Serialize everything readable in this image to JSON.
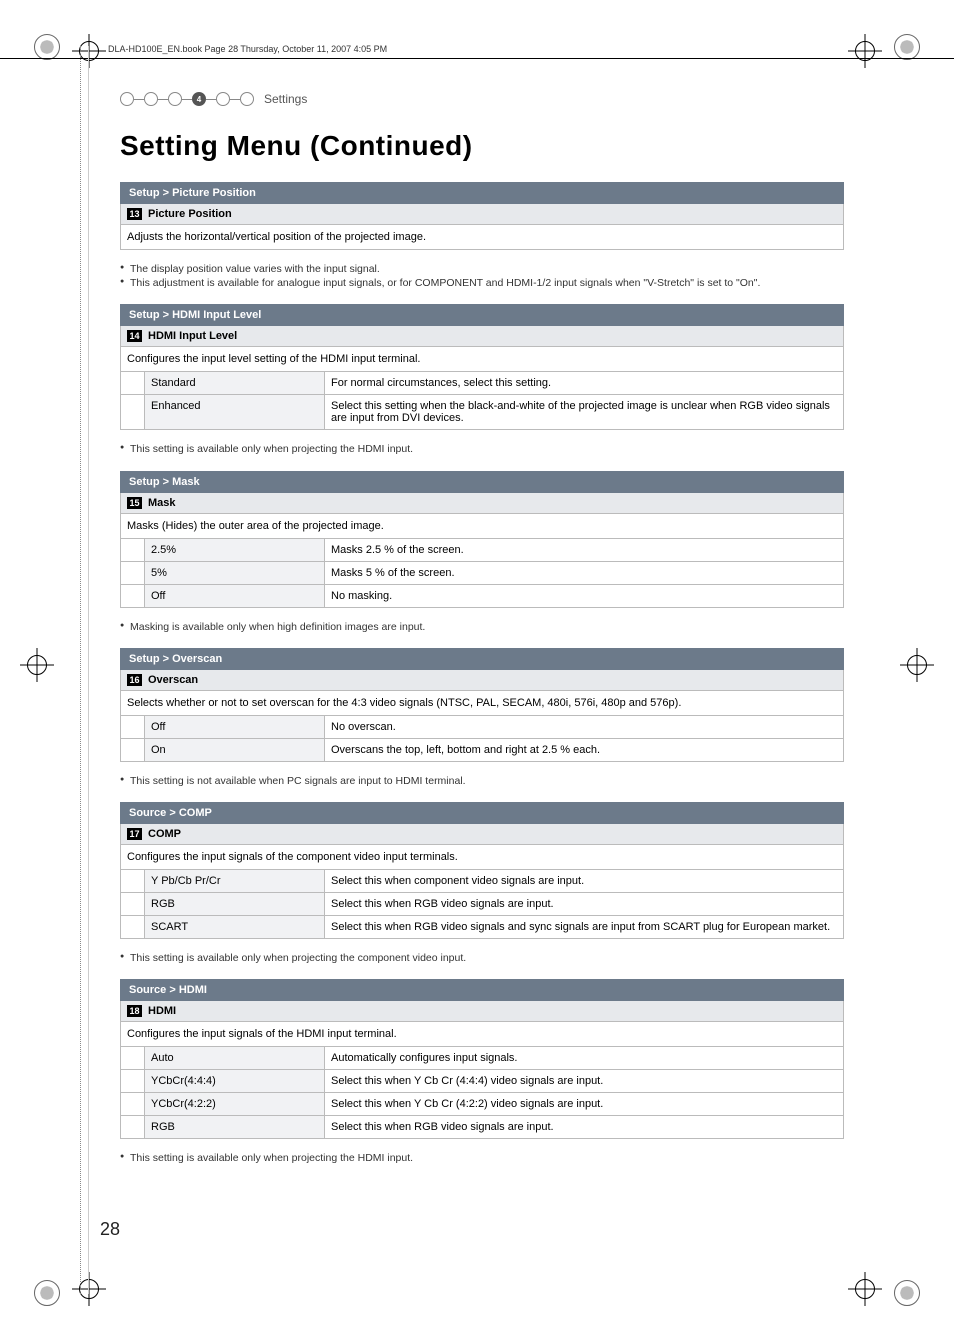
{
  "book_header": "DLA-HD100E_EN.book  Page 28  Thursday, October 11, 2007  4:05 PM",
  "progress": {
    "step": "4",
    "label": "Settings"
  },
  "page_title": "Setting Menu (Continued)",
  "page_number": "28",
  "sections": [
    {
      "breadcrumb": "Setup > Picture Position",
      "tag": "13",
      "sub": "Picture Position",
      "desc": "Adjusts the horizontal/vertical position of the projected image.",
      "options": [],
      "notes": [
        "The display position value varies with the input signal.",
        "This adjustment is available for analogue input signals, or for COMPONENT and HDMI-1/2 input signals when \"V-Stretch\" is set to \"On\"."
      ]
    },
    {
      "breadcrumb": "Setup > HDMI Input Level",
      "tag": "14",
      "sub": "HDMI Input Level",
      "desc": "Configures the input level setting of the HDMI input terminal.",
      "options": [
        {
          "key": "Standard",
          "val": "For normal circumstances, select this setting."
        },
        {
          "key": "Enhanced",
          "val": "Select this setting when the black-and-white of the projected image is unclear when RGB video signals are input from DVI devices."
        }
      ],
      "notes": [
        "This setting is available only when projecting the HDMI input."
      ]
    },
    {
      "breadcrumb": "Setup > Mask",
      "tag": "15",
      "sub": "Mask",
      "desc": "Masks (Hides) the outer area of the projected image.",
      "options": [
        {
          "key": "2.5%",
          "val": "Masks 2.5 % of the screen."
        },
        {
          "key": "5%",
          "val": "Masks 5 % of the screen."
        },
        {
          "key": "Off",
          "val": "No masking."
        }
      ],
      "notes": [
        "Masking is available only when high definition images are input."
      ]
    },
    {
      "breadcrumb": "Setup > Overscan",
      "tag": "16",
      "sub": "Overscan",
      "desc": "Selects whether or not to set overscan for the 4:3 video signals (NTSC, PAL, SECAM, 480i, 576i, 480p and 576p).",
      "options": [
        {
          "key": "Off",
          "val": "No overscan."
        },
        {
          "key": "On",
          "val": "Overscans the top, left, bottom and right at 2.5 % each."
        }
      ],
      "notes": [
        "This setting is not available when PC signals are input to HDMI terminal."
      ]
    },
    {
      "breadcrumb": "Source > COMP",
      "tag": "17",
      "sub": "COMP",
      "desc": "Configures the input signals of the component video input terminals.",
      "options": [
        {
          "key": "Y Pb/Cb Pr/Cr",
          "val": "Select this when component video signals are input."
        },
        {
          "key": "RGB",
          "val": "Select this when RGB video signals are input."
        },
        {
          "key": "SCART",
          "val": "Select this when RGB video signals and sync signals are input from SCART plug for European market."
        }
      ],
      "notes": [
        "This setting is available only when projecting the component video input."
      ]
    },
    {
      "breadcrumb": "Source > HDMI",
      "tag": "18",
      "sub": "HDMI",
      "desc": "Configures the input signals of the HDMI input terminal.",
      "options": [
        {
          "key": "Auto",
          "val": "Automatically configures input signals."
        },
        {
          "key": "YCbCr(4:4:4)",
          "val": "Select this when Y Cb Cr (4:4:4) video signals are input."
        },
        {
          "key": "YCbCr(4:2:2)",
          "val": "Select this when Y Cb Cr (4:2:2) video signals are input."
        },
        {
          "key": "RGB",
          "val": "Select this when RGB video signals are input."
        }
      ],
      "notes": [
        "This setting is available only when projecting the HDMI input."
      ]
    }
  ]
}
